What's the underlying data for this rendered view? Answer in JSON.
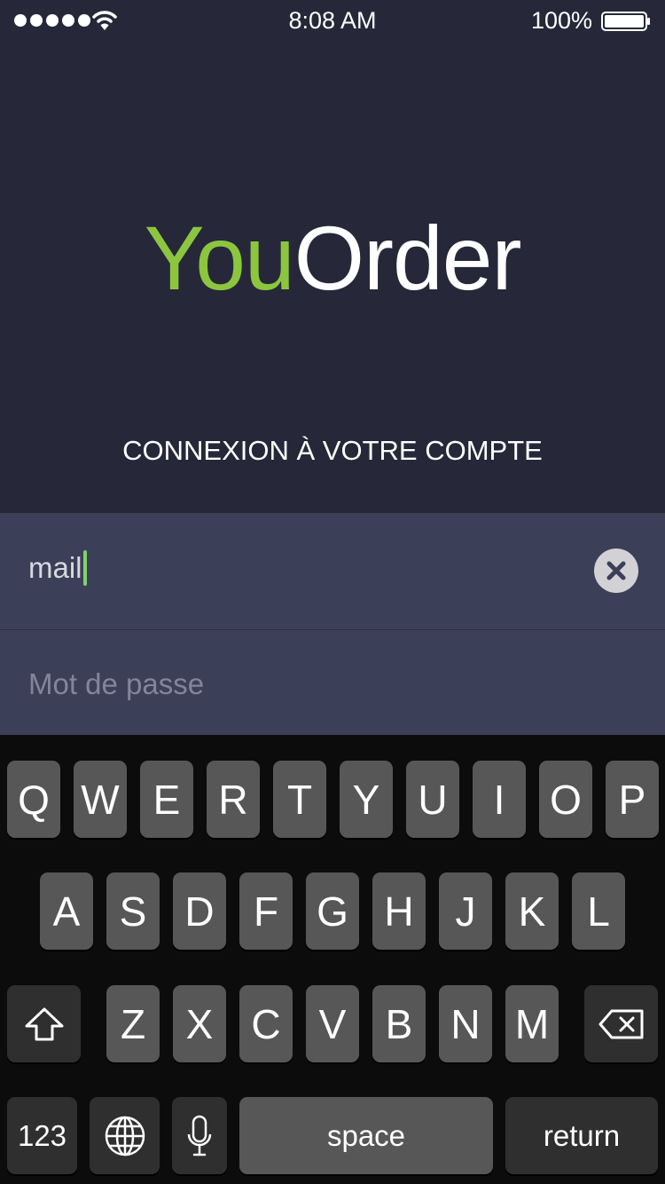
{
  "status_bar": {
    "time": "8:08 AM",
    "battery_percent": "100%",
    "signal_bars": 5,
    "icons": [
      "signal-dots-icon",
      "wifi-icon",
      "battery-icon"
    ]
  },
  "app": {
    "logo_part1": "You",
    "logo_part2": "Order",
    "subtitle": "CONNEXION À VOTRE COMPTE",
    "accent_color": "#8cc63f"
  },
  "form": {
    "email_value": "mail",
    "password_placeholder": "Mot de passe"
  },
  "keyboard": {
    "row1": [
      "Q",
      "W",
      "E",
      "R",
      "T",
      "Y",
      "U",
      "I",
      "O",
      "P"
    ],
    "row2": [
      "A",
      "S",
      "D",
      "F",
      "G",
      "H",
      "J",
      "K",
      "L"
    ],
    "row3": [
      "Z",
      "X",
      "C",
      "V",
      "B",
      "N",
      "M"
    ],
    "numbers_label": "123",
    "space_label": "space",
    "return_label": "return",
    "icons": [
      "shift-icon",
      "backspace-icon",
      "globe-icon",
      "microphone-icon"
    ]
  }
}
